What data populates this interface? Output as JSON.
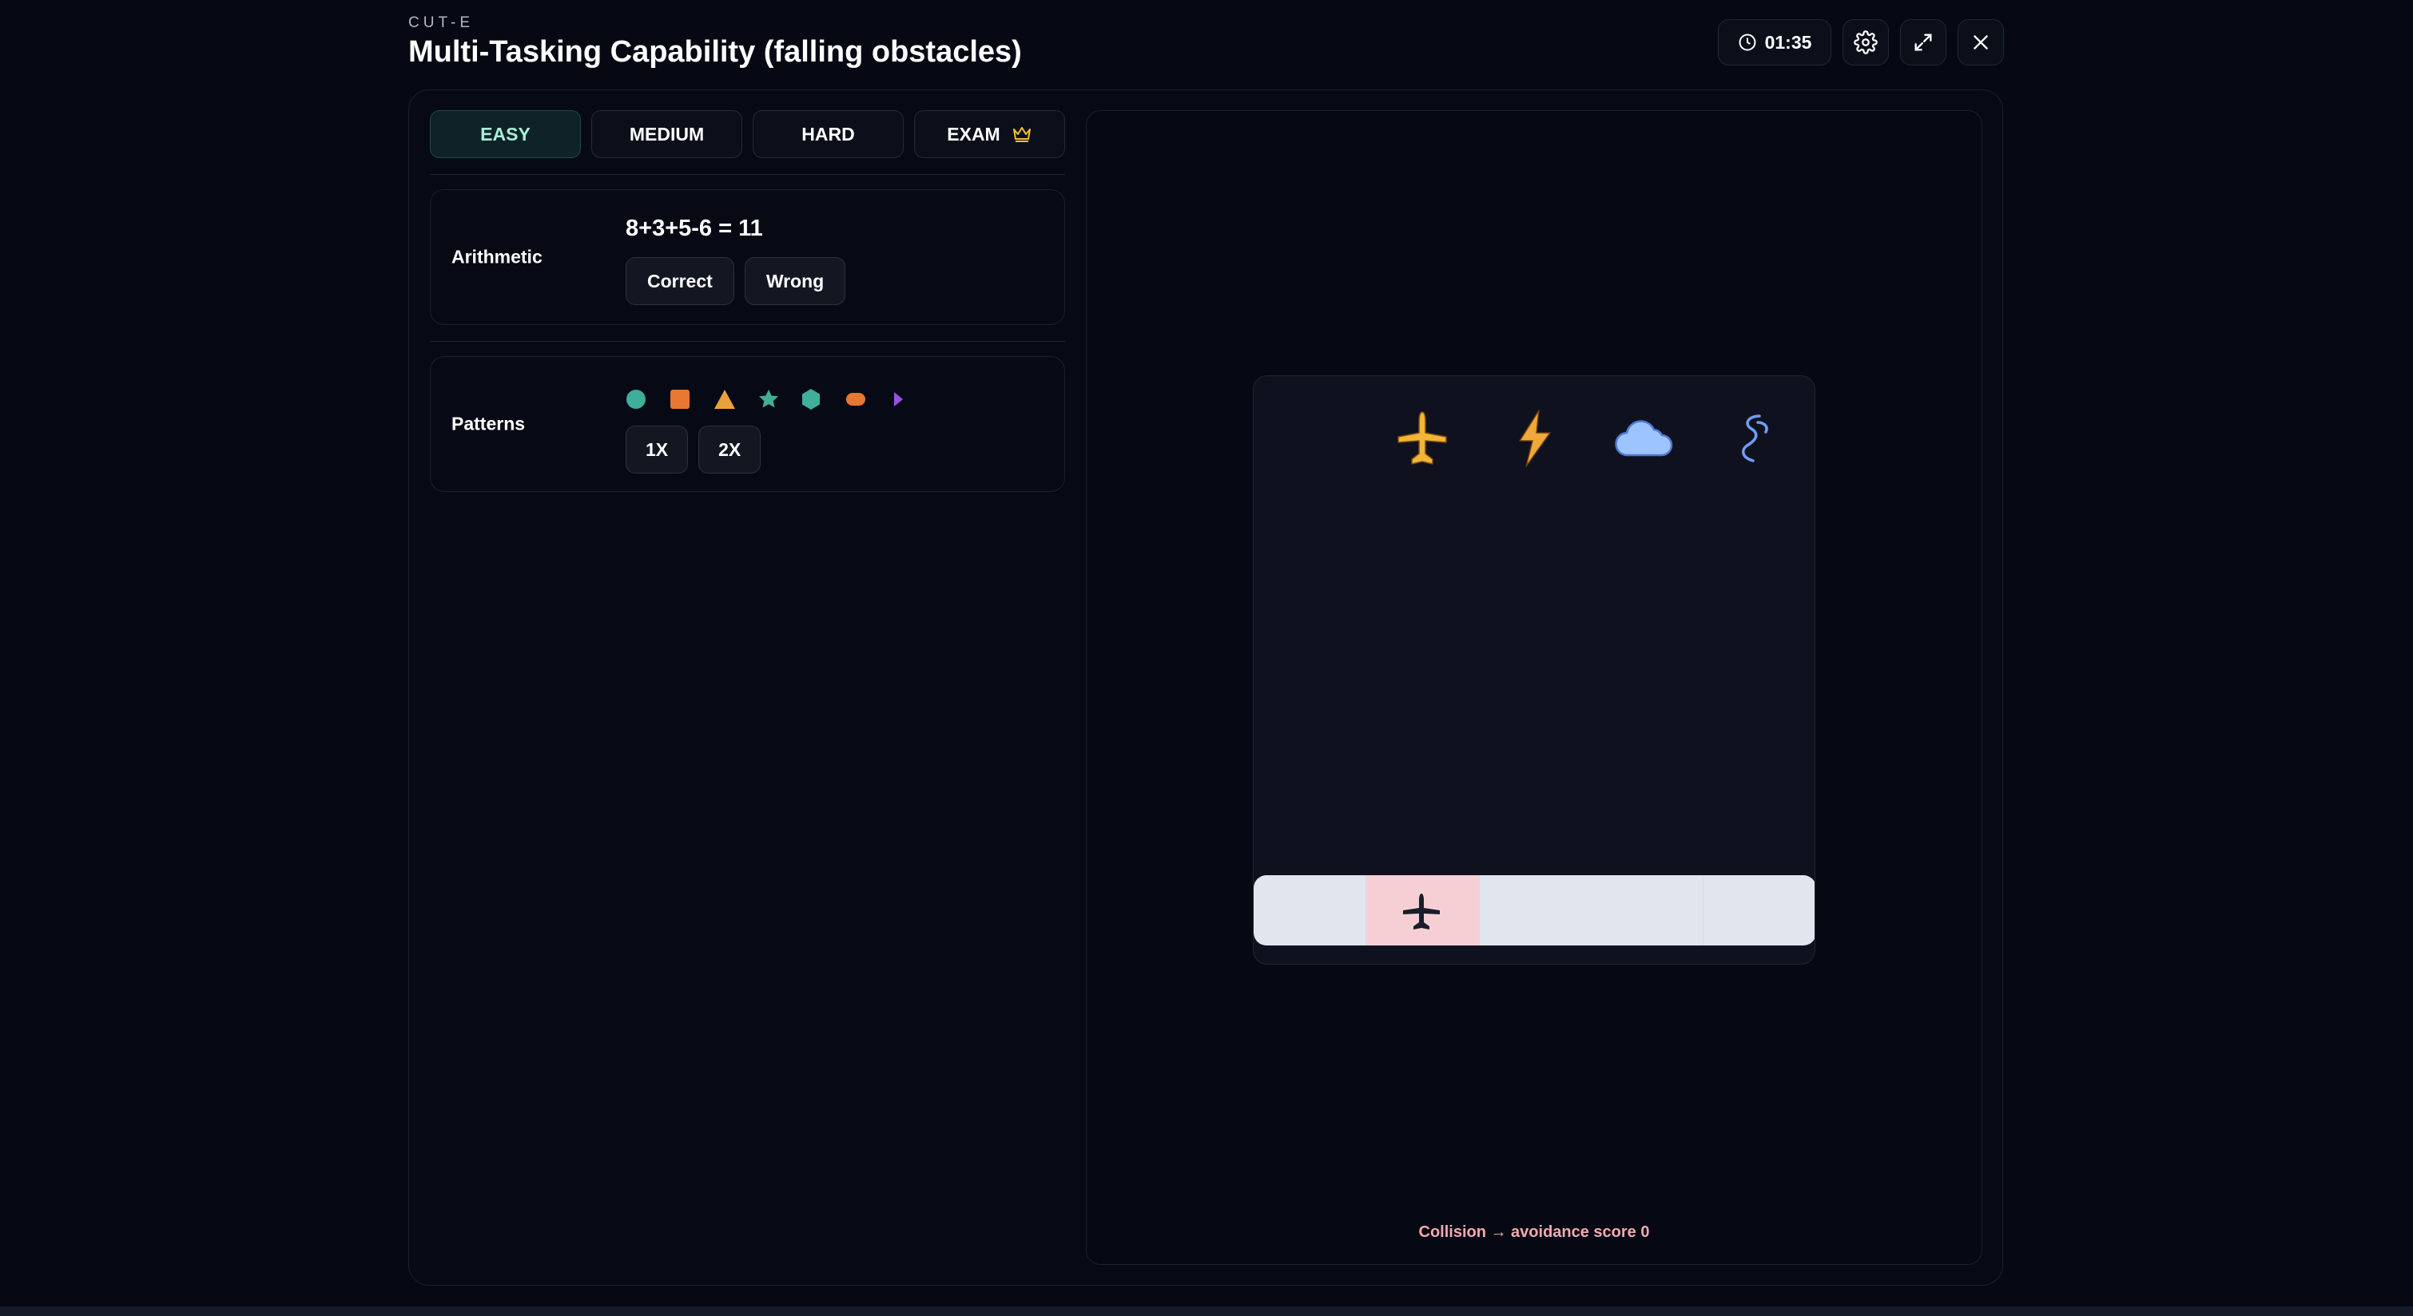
{
  "header": {
    "brand": "CUT-E",
    "title": "Multi-Tasking Capability (falling obstacles)"
  },
  "controls": {
    "timer": "01:35"
  },
  "tabs": [
    {
      "label": "EASY",
      "active": true
    },
    {
      "label": "MEDIUM",
      "active": false
    },
    {
      "label": "HARD",
      "active": false
    },
    {
      "label": "EXAM",
      "active": false,
      "icon": "crown-icon"
    }
  ],
  "arithmetic": {
    "label": "Arithmetic",
    "equation": "8+3+5-6 = 11",
    "correct_label": "Correct",
    "wrong_label": "Wrong"
  },
  "patterns": {
    "label": "Patterns",
    "shapes": [
      "circle",
      "square",
      "triangle",
      "star",
      "hexagon",
      "oval",
      "play"
    ],
    "btn_1x": "1X",
    "btn_2x": "2X"
  },
  "game": {
    "obstacles": [
      "airplane-icon",
      "lightning-icon",
      "cloud-icon",
      "smoke-icon"
    ],
    "player_lane": 1,
    "status": "Collision → avoidance score 0"
  },
  "colors": {
    "accent": "#a9f0d8",
    "status": "#f2a9b0",
    "teal": "#3fae9b",
    "orange": "#e8782f",
    "amber": "#e9a23b",
    "purple": "#9b4fe0",
    "yellow": "#f2b535",
    "cloud": "#9ec4ff",
    "lane_highlight": "#f6cfd5"
  }
}
